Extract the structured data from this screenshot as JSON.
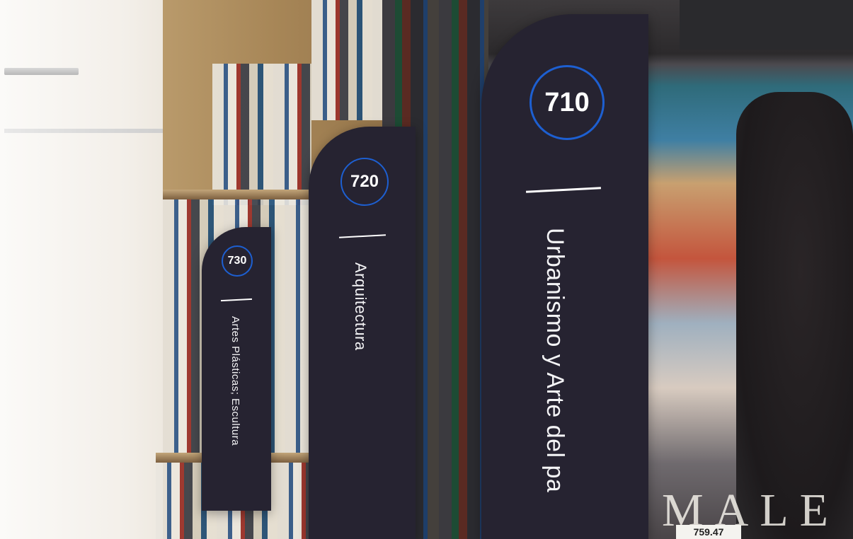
{
  "labels": [
    {
      "number": "710",
      "title": "Urbanismo y Arte del pa"
    },
    {
      "number": "720",
      "title": "Arquitectura"
    },
    {
      "number": "730",
      "title": "Artes Plásticas; Escultura"
    }
  ],
  "background": {
    "cover_letters": "MALE",
    "spine_tag": "759.47"
  },
  "colors": {
    "card_background": "#262331",
    "circle_accent": "#1d5fd1",
    "text": "#ffffff"
  }
}
